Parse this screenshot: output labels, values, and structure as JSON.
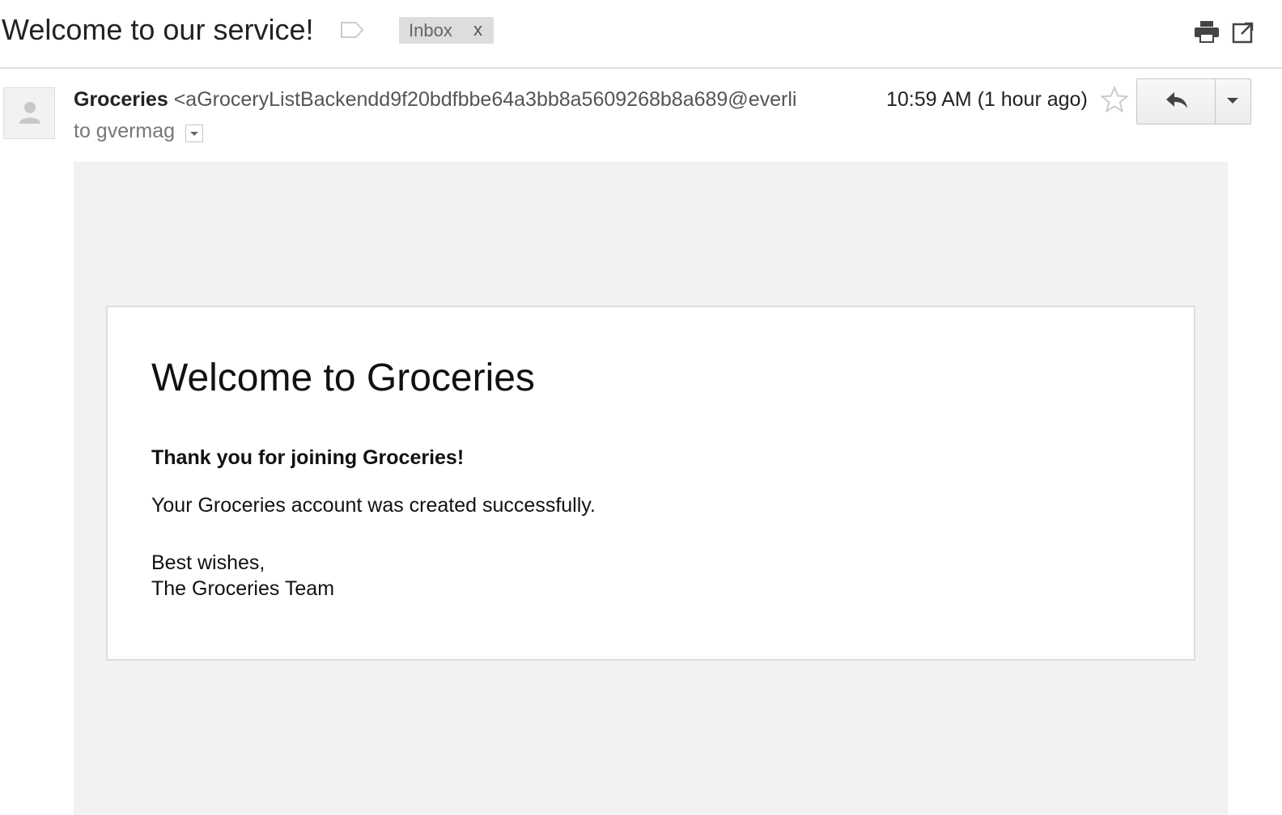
{
  "header": {
    "subject": "Welcome to our service!",
    "label_chip": "Inbox",
    "label_remove": "x"
  },
  "message": {
    "sender_name": "Groceries",
    "sender_email": "<aGroceryListBackendd9f20bdfbbe64a3bb8a5609268b8a689@everli",
    "to_line": "to gvermag",
    "timestamp": "10:59 AM (1 hour ago)"
  },
  "body": {
    "heading": "Welcome to Groceries",
    "thanks": "Thank you for joining Groceries!",
    "text": "Your Groceries account was created successfully.",
    "signoff_1": "Best wishes,",
    "signoff_2": "The Groceries Team"
  },
  "icons": {
    "label": "label-icon",
    "print": "print-icon",
    "new_window": "new-window-icon",
    "star": "star-icon",
    "reply": "reply-icon",
    "more": "chevron-down-icon",
    "avatar": "person-icon"
  },
  "colors": {
    "chip_bg": "#dddddd",
    "body_bg": "#f2f2f2",
    "text": "#222222"
  }
}
